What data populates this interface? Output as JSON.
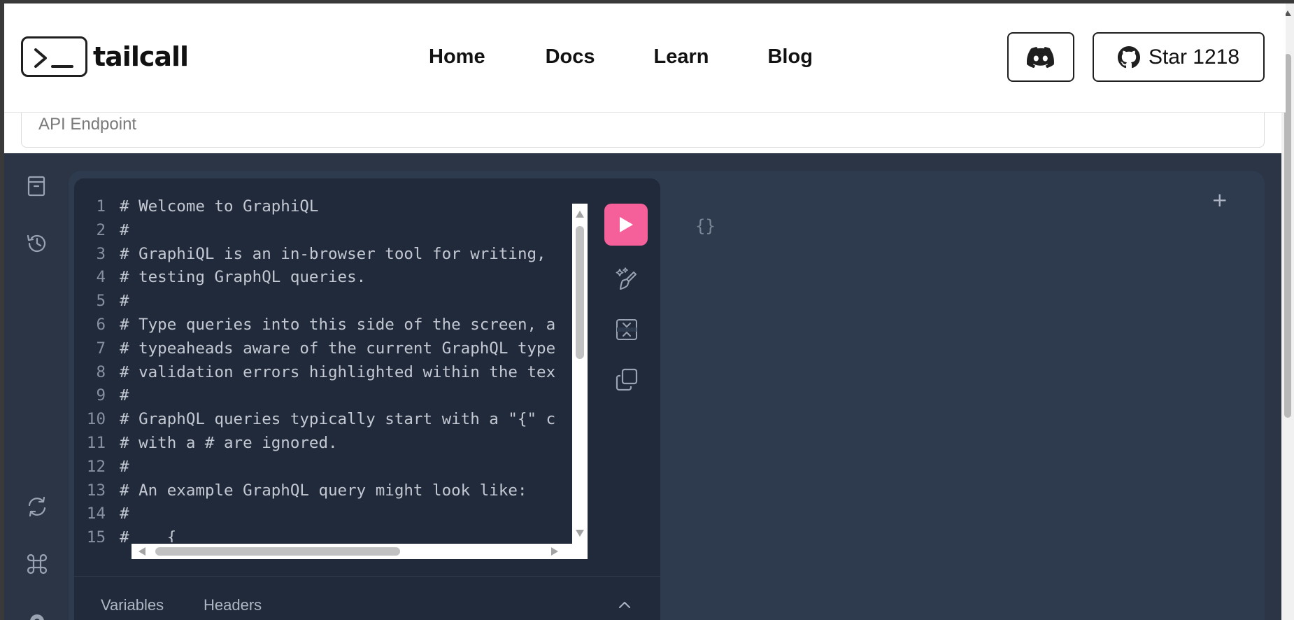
{
  "header": {
    "logo_text": "tailcall",
    "nav": [
      {
        "label": "Home"
      },
      {
        "label": "Docs"
      },
      {
        "label": "Learn"
      },
      {
        "label": "Blog"
      }
    ],
    "star_label": "Star 1218"
  },
  "endpoint": {
    "placeholder": "API Endpoint"
  },
  "editor": {
    "lines": [
      {
        "n": "1",
        "text": "# Welcome to GraphiQL"
      },
      {
        "n": "2",
        "text": "#"
      },
      {
        "n": "3",
        "text": "# GraphiQL is an in-browser tool for writing,"
      },
      {
        "n": "4",
        "text": "# testing GraphQL queries."
      },
      {
        "n": "5",
        "text": "#"
      },
      {
        "n": "6",
        "text": "# Type queries into this side of the screen, a"
      },
      {
        "n": "7",
        "text": "# typeaheads aware of the current GraphQL type"
      },
      {
        "n": "8",
        "text": "# validation errors highlighted within the tex"
      },
      {
        "n": "9",
        "text": "#"
      },
      {
        "n": "10",
        "text": "# GraphQL queries typically start with a \"{\" c"
      },
      {
        "n": "11",
        "text": "# with a # are ignored."
      },
      {
        "n": "12",
        "text": "#"
      },
      {
        "n": "13",
        "text": "# An example GraphQL query might look like:"
      },
      {
        "n": "14",
        "text": "#"
      },
      {
        "n": "15",
        "text": "#    {"
      }
    ]
  },
  "bottom_tabs": {
    "variables": "Variables",
    "headers": "Headers"
  },
  "result": {
    "placeholder": "{}"
  },
  "add_tab_label": "+",
  "colors": {
    "run_button": "#f5609a",
    "editor_bg": "#202a3a",
    "session_bg": "#2e3a4d"
  }
}
